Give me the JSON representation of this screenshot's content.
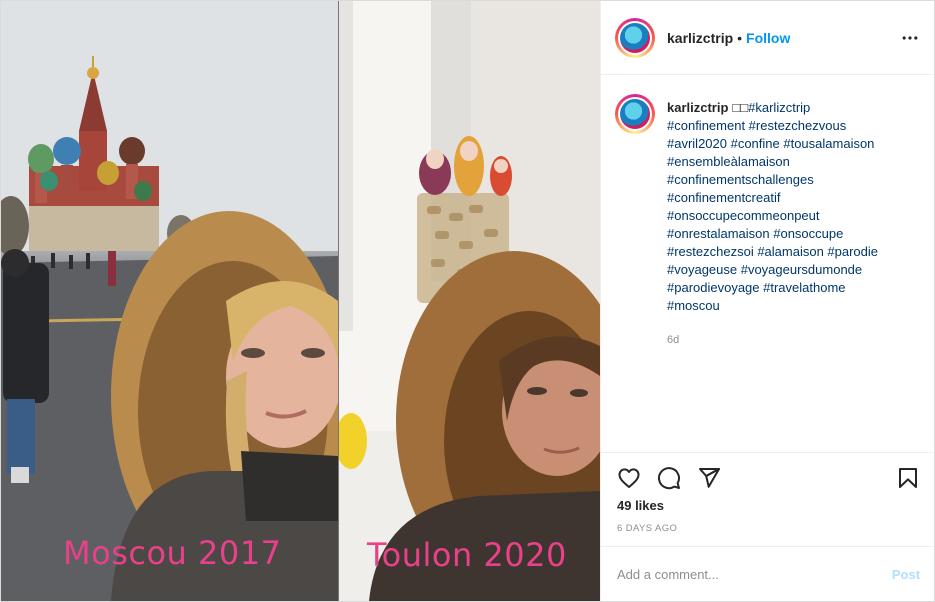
{
  "photo": {
    "left_caption": "Moscou 2017",
    "right_caption": "Toulon 2020"
  },
  "header": {
    "username": "karlizctrip",
    "separator": "•",
    "follow_label": "Follow",
    "more_icon": "more-options-icon"
  },
  "caption": {
    "username": "karlizctrip",
    "emoji": "□□",
    "hashtags_inline": "#karlizctrip",
    "lines": [
      "#confinement #restezchezvous",
      "#avril2020 #confine #tousalamaison",
      "#ensembleàlamaison",
      "#confinementschallenges",
      "#confinementcreatif",
      "#onsoccupecommeonpeut",
      "#onrestalamaison #onsoccupe",
      "#restezchezsoi #alamaison #parodie",
      "#voyageuse #voyageursdumonde",
      "#parodievoyage #travelathome",
      "#moscou"
    ],
    "age": "6d"
  },
  "actions": {
    "icons": [
      "heart-icon",
      "comment-icon",
      "share-icon",
      "bookmark-icon"
    ],
    "likes": "49 likes",
    "time_ago": "6 DAYS AGO"
  },
  "comment_box": {
    "placeholder": "Add a comment...",
    "post_label": "Post"
  },
  "colors": {
    "link_blue": "#0095f6",
    "hashtag": "#00376b",
    "overlay_pink": "#e8418a",
    "post_disabled": "#b2dffc"
  }
}
